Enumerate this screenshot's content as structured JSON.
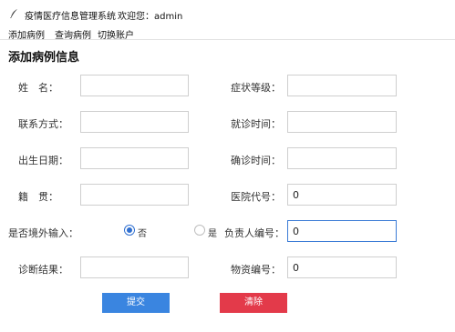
{
  "window": {
    "app_title": "疫情医疗信息管理系统",
    "welcome": "欢迎您：admin"
  },
  "menu": {
    "add": "添加病例",
    "query": "查询病例",
    "switch": "切换账户"
  },
  "form": {
    "title": "添加病例信息",
    "name_label": "姓　名：",
    "name_value": "",
    "symptom_label": "症状等级：",
    "symptom_value": "",
    "contact_label": "联系方式：",
    "contact_value": "",
    "visit_time_label": "就诊时间：",
    "visit_time_value": "",
    "birth_label": "出生日期：",
    "birth_value": "",
    "confirm_time_label": "确诊时间：",
    "confirm_time_value": "",
    "origin_label": "籍　贯：",
    "origin_value": "",
    "hospital_code_label": "医院代号：",
    "hospital_code_value": "0",
    "overseas_label": "是否境外输入：",
    "overseas_options": [
      {
        "label": "否",
        "checked": true
      },
      {
        "label": "是",
        "checked": false
      }
    ],
    "responsible_label": "负责人编号：",
    "responsible_value": "0",
    "diagnosis_label": "诊断结果：",
    "diagnosis_value": "",
    "supplies_label": "物资编号：",
    "supplies_value": "0"
  },
  "buttons": {
    "submit": "提交",
    "clear": "清除"
  },
  "colors": {
    "submit": "#3a85e0",
    "clear": "#e33a4a",
    "focus": "#3b7bd6"
  },
  "icons": {
    "app": "feather-pen-icon"
  }
}
